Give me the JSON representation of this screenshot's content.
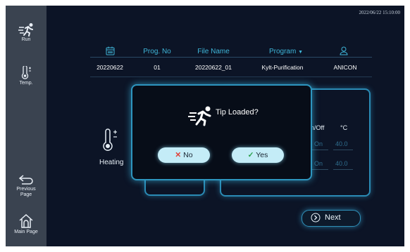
{
  "datetime": "2022/06/22 15:10:00",
  "sidebar": {
    "run": "Run",
    "temp": "Temp.",
    "previous": "Previous Page",
    "main_page": "Main Page"
  },
  "table": {
    "headers": [
      "Prog. No",
      "File Name",
      "Program",
      ""
    ],
    "row": [
      "20220622",
      "01",
      "20220622_01",
      "Kylt-Purification",
      "ANICON"
    ]
  },
  "background": {
    "heating_label": "Heating",
    "onoff_header": "n/Off",
    "temp_unit": "°C",
    "rows": [
      {
        "state": "On",
        "value": "40.0"
      },
      {
        "state": "On",
        "value": "40.0"
      }
    ],
    "next": "Next"
  },
  "modal": {
    "title": "Tip Loaded?",
    "no": "No",
    "yes": "Yes"
  },
  "colors": {
    "background": "#0c1426",
    "sidebar": "#3a4350",
    "accent": "#3fb6d9",
    "pill": "#c4ecf7"
  }
}
